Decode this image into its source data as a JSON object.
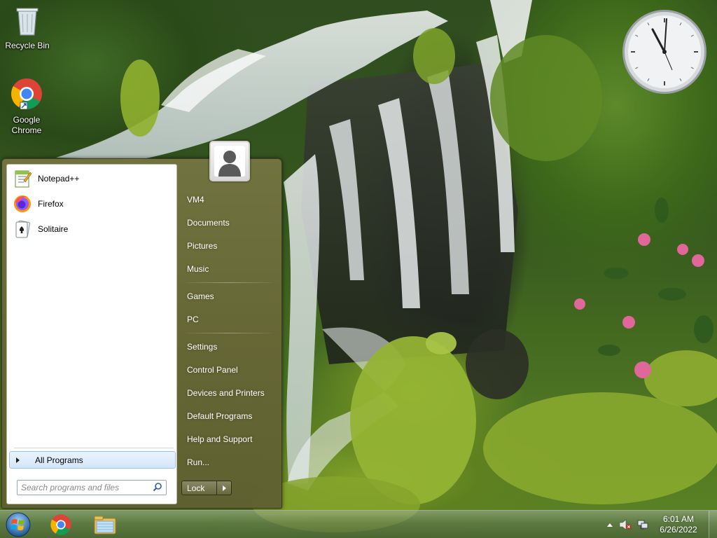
{
  "desktop": {
    "icons": [
      {
        "label": "Recycle Bin",
        "icon": "recycle-bin-icon"
      },
      {
        "label": "Google Chrome",
        "icon": "chrome-icon"
      }
    ]
  },
  "start_menu": {
    "programs": [
      {
        "label": "Notepad++",
        "icon": "notepad-plus-plus-icon"
      },
      {
        "label": "Firefox",
        "icon": "firefox-icon"
      },
      {
        "label": "Solitaire",
        "icon": "solitaire-icon"
      }
    ],
    "all_programs_label": "All Programs",
    "search_placeholder": "Search programs and files",
    "right_items": [
      {
        "label": "VM4"
      },
      {
        "label": "Documents"
      },
      {
        "label": "Pictures"
      },
      {
        "label": "Music"
      },
      {
        "label": "Games"
      },
      {
        "label": "PC"
      },
      {
        "label": "Settings"
      },
      {
        "label": "Control Panel"
      },
      {
        "label": "Devices and Printers"
      },
      {
        "label": "Default Programs"
      },
      {
        "label": "Help and Support"
      },
      {
        "label": "Run..."
      }
    ],
    "lock_label": "Lock"
  },
  "taskbar": {
    "pinned": [
      "start-orb-icon",
      "chrome-icon",
      "file-explorer-icon"
    ],
    "tray": {
      "time": "6:01 AM",
      "date": "6/26/2022",
      "icons": [
        "show-hidden-icons-arrow",
        "volume-muted-icon",
        "network-icon"
      ]
    }
  },
  "colors": {
    "start_menu_frame": "#6b6b38",
    "all_programs_highlight": "#d4e6fa",
    "taskbar": "#5f735a"
  }
}
